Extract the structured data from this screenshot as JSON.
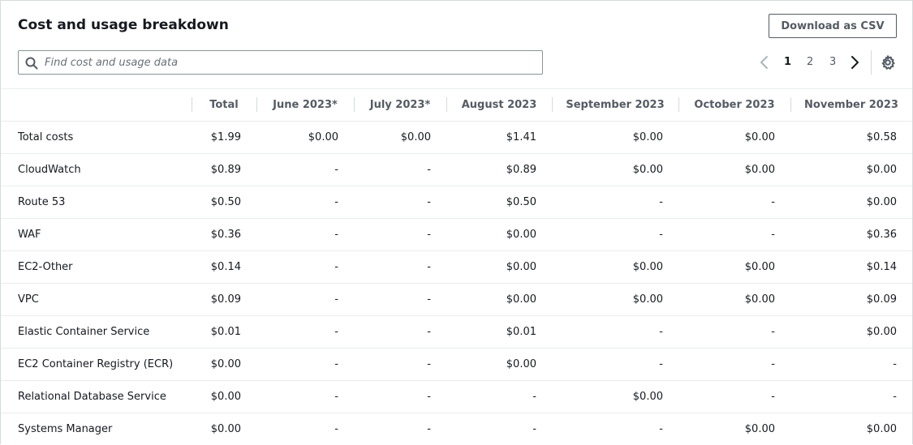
{
  "panel": {
    "title": "Cost and usage breakdown",
    "download_label": "Download as CSV"
  },
  "search": {
    "placeholder": "Find cost and usage data",
    "value": ""
  },
  "pagination": {
    "pages": [
      "1",
      "2",
      "3"
    ],
    "current_page": "1"
  },
  "icons": {
    "search": "search-icon",
    "prev": "chevron-left-icon",
    "next": "chevron-right-icon",
    "settings": "gear-icon"
  },
  "colors": {
    "text": "#16191f",
    "muted_text": "#545b64",
    "border": "#d5dbdb",
    "disabled": "#aab7b8"
  },
  "table": {
    "columns": [
      "",
      "Total",
      "June 2023*",
      "July 2023*",
      "August 2023",
      "September 2023",
      "October 2023",
      "November 2023"
    ],
    "rows": [
      {
        "service": "Total costs",
        "values": [
          "$1.99",
          "$0.00",
          "$0.00",
          "$1.41",
          "$0.00",
          "$0.00",
          "$0.58"
        ]
      },
      {
        "service": "CloudWatch",
        "values": [
          "$0.89",
          "-",
          "-",
          "$0.89",
          "$0.00",
          "$0.00",
          "$0.00"
        ]
      },
      {
        "service": "Route 53",
        "values": [
          "$0.50",
          "-",
          "-",
          "$0.50",
          "-",
          "-",
          "$0.00"
        ]
      },
      {
        "service": "WAF",
        "values": [
          "$0.36",
          "-",
          "-",
          "$0.00",
          "-",
          "-",
          "$0.36"
        ]
      },
      {
        "service": "EC2-Other",
        "values": [
          "$0.14",
          "-",
          "-",
          "$0.00",
          "$0.00",
          "$0.00",
          "$0.14"
        ]
      },
      {
        "service": "VPC",
        "values": [
          "$0.09",
          "-",
          "-",
          "$0.00",
          "$0.00",
          "$0.00",
          "$0.09"
        ]
      },
      {
        "service": "Elastic Container Service",
        "values": [
          "$0.01",
          "-",
          "-",
          "$0.01",
          "-",
          "-",
          "$0.00"
        ]
      },
      {
        "service": "EC2 Container Registry (ECR)",
        "values": [
          "$0.00",
          "-",
          "-",
          "$0.00",
          "-",
          "-",
          "-"
        ]
      },
      {
        "service": "Relational Database Service",
        "values": [
          "$0.00",
          "-",
          "-",
          "-",
          "$0.00",
          "-",
          "-"
        ]
      },
      {
        "service": "Systems Manager",
        "values": [
          "$0.00",
          "-",
          "-",
          "-",
          "-",
          "$0.00",
          "$0.00"
        ]
      }
    ]
  }
}
